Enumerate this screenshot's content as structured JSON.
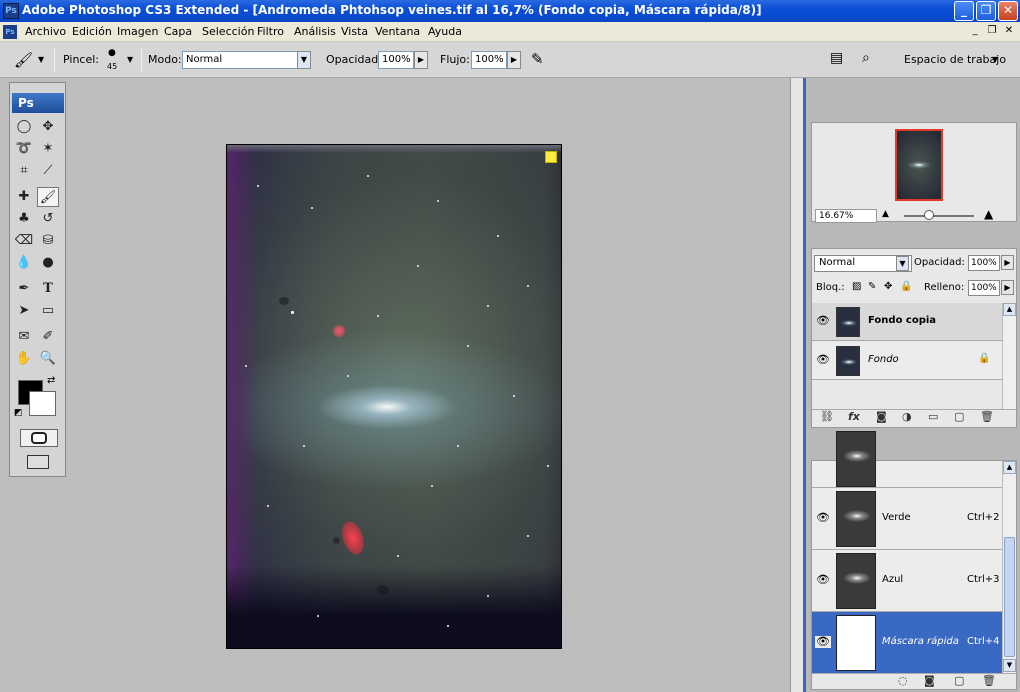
{
  "window": {
    "title": "Adobe Photoshop CS3 Extended - [Andromeda Phtohsop veines.tif al 16,7% (Fondo copia, Máscara rápida/8)]",
    "app_icon_text": "Ps",
    "controls": {
      "minimize": "_",
      "restore": "❐",
      "close": "✕"
    }
  },
  "menubar": {
    "items": [
      "Archivo",
      "Edición",
      "Imagen",
      "Capa",
      "Selección",
      "Filtro",
      "Análisis",
      "Vista",
      "Ventana",
      "Ayuda"
    ],
    "mdi": {
      "minimize": "_",
      "restore": "❐",
      "close": "✕"
    }
  },
  "options": {
    "brush_label": "Pincel:",
    "brush_size": "45",
    "mode_label": "Modo:",
    "mode_value": "Normal",
    "opacity_label": "Opacidad:",
    "opacity_value": "100%",
    "flow_label": "Flujo:",
    "flow_value": "100%",
    "workspace_label": "Espacio de trabajo"
  },
  "tools_panel": {
    "logo": "Ps"
  },
  "navigator": {
    "zoom": "16.67%"
  },
  "layers": {
    "blend_mode": "Normal",
    "opacity_label": "Opacidad:",
    "opacity_value": "100%",
    "lock_label": "Bloq.:",
    "fill_label": "Relleno:",
    "fill_value": "100%",
    "items": [
      {
        "name": "Fondo copia",
        "selected": true
      },
      {
        "name": "Fondo",
        "selected": false,
        "locked": true
      }
    ]
  },
  "channels": {
    "items": [
      {
        "name": "Verde",
        "shortcut": "Ctrl+2"
      },
      {
        "name": "Azul",
        "shortcut": "Ctrl+3"
      },
      {
        "name": "Máscara rápida",
        "shortcut": "Ctrl+4",
        "selected": true
      }
    ]
  },
  "colors": {
    "title_bar": "#0b4fd8",
    "selection": "#3a69c4",
    "foreground": "#000000",
    "background": "#ffffff"
  }
}
